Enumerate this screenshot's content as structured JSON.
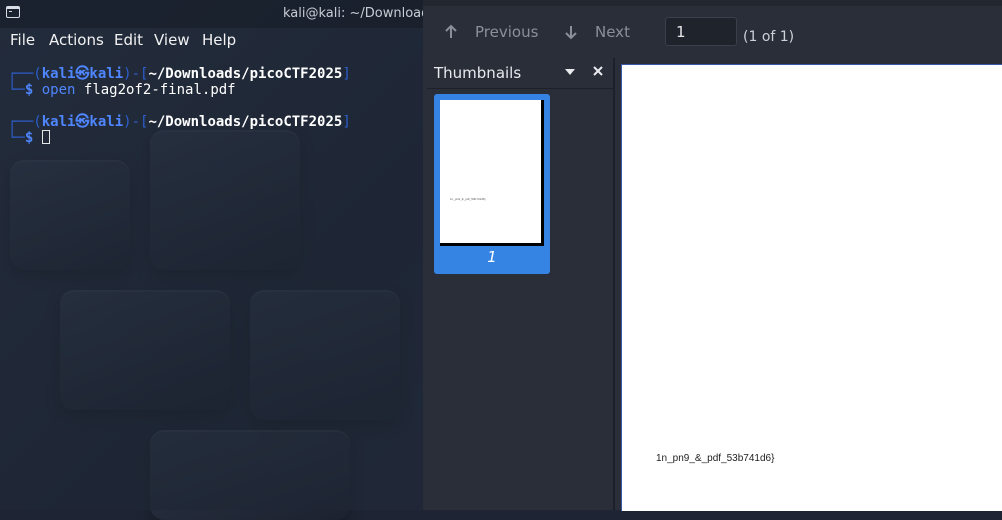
{
  "terminal": {
    "title": "kali@kali: ~/Downloads/p",
    "menu": [
      "File",
      "Actions",
      "Edit",
      "View",
      "Help"
    ],
    "lines": [
      {
        "frame": "┌──(",
        "user": "kali㉿kali",
        "mid": ")-[",
        "path": "~/Downloads/picoCTF2025",
        "end": "]"
      },
      {
        "frame": "└─",
        "prompt": "$",
        "cmd": "open",
        "arg": "flag2of2-final.pdf"
      },
      {
        "frame": "┌──(",
        "user": "kali㉿kali",
        "mid": ")-[",
        "path": "~/Downloads/picoCTF2025",
        "end": "]"
      },
      {
        "frame": "└─",
        "prompt": "$"
      }
    ]
  },
  "viewer": {
    "toolbar": {
      "previous_label": "Previous",
      "next_label": "Next",
      "page_value": "1",
      "page_count": "(1 of 1)"
    },
    "sidebar": {
      "title": "Thumbnails",
      "thumb_number": "1",
      "thumb_text": "1n_pn9_&_pdf_53b741d6}"
    },
    "page_text": "1n_pn9_&_pdf_53b741d6}"
  },
  "colors": {
    "accent": "#3584e4",
    "prompt_blue": "#4f86ff",
    "viewer_bg": "#2a2e39"
  },
  "icons": [
    "terminal-app-icon",
    "arrow-up-icon",
    "arrow-down-icon",
    "dropdown-triangle-icon",
    "close-icon"
  ]
}
